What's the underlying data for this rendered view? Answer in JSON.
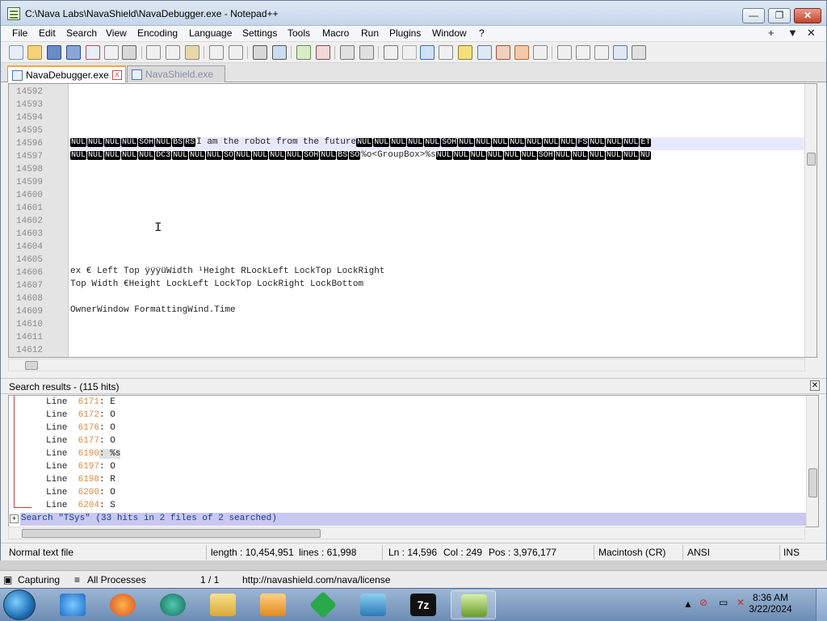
{
  "window": {
    "title": "C:\\Nava Labs\\NavaShield\\NavaDebugger.exe - Notepad++",
    "minimize": "—",
    "maximize": "❐",
    "close": "✕"
  },
  "menu": {
    "items": [
      "File",
      "Edit",
      "Search",
      "View",
      "Encoding",
      "Language",
      "Settings",
      "Tools",
      "Macro",
      "Run",
      "Plugins",
      "Window",
      "?"
    ],
    "right": [
      "+",
      "▼",
      "✕"
    ]
  },
  "tabs": [
    {
      "label": "NavaDebugger.exe",
      "active": true
    },
    {
      "label": "NavaShield.exe",
      "active": false
    }
  ],
  "editor": {
    "lines": [
      {
        "num": "14592",
        "text": ""
      },
      {
        "num": "14593",
        "text": ""
      },
      {
        "num": "14594",
        "text": ""
      },
      {
        "num": "14595",
        "text": ""
      },
      {
        "num": "14596",
        "text": "I am the robot from the future",
        "highlight": true
      },
      {
        "num": "14597",
        "text": "%o<GroupBox>%s"
      },
      {
        "num": "14598",
        "text": ""
      },
      {
        "num": "14599",
        "text": ""
      },
      {
        "num": "14600",
        "text": ""
      },
      {
        "num": "14601",
        "text": ""
      },
      {
        "num": "14602",
        "text": ""
      },
      {
        "num": "14603",
        "text": ""
      },
      {
        "num": "14604",
        "text": ""
      },
      {
        "num": "14605",
        "text": ""
      },
      {
        "num": "14606",
        "text": "ex €  Left   Top ÿÿÿüWidth  ¹Height  RLockLeft LockTop LockRight"
      },
      {
        "num": "14607",
        "text": "Top  Width  €Height  LockLeft LockTop LockRight LockBottom"
      },
      {
        "num": "14608",
        "text": ""
      },
      {
        "num": "14609",
        "text": "OwnerWindow  FormattingWind.Time"
      },
      {
        "num": "14610",
        "text": ""
      },
      {
        "num": "14611",
        "text": ""
      },
      {
        "num": "14612",
        "text": ""
      }
    ],
    "ctrl": {
      "l14596a": [
        "NUL",
        "NUL",
        "NUL",
        "NUL",
        "SOH",
        "NUL",
        "BS",
        "RS"
      ],
      "l14596b": [
        "NUL",
        "NUL",
        "NUL",
        "NUL",
        "NUL",
        "SOH",
        "NUL",
        "NUL",
        "NUL",
        "NUL",
        "NUL",
        "NUL",
        "NUL",
        "FS",
        "NUL",
        "NUL",
        "NUL",
        "ET"
      ],
      "l14597a": [
        "NUL",
        "NUL",
        "NUL",
        "NUL",
        "NUL",
        "DC3",
        "NUL",
        "NUL",
        "NUL",
        "SO",
        "NUL",
        "NUL",
        "NUL",
        "NUL",
        "SOH",
        "NUL",
        "BS",
        "SO"
      ],
      "l14597b": [
        "NUL",
        "NUL",
        "NUL",
        "NUL",
        "NUL",
        "NUL",
        "SOH",
        "NUL",
        "NUL",
        "NUL",
        "NUL",
        "NUL",
        "NU"
      ]
    }
  },
  "search_panel": {
    "title": "Search results - (115 hits)",
    "close": "✕",
    "results": [
      {
        "prefix": "Line  ",
        "num": "6171",
        "text": ": E"
      },
      {
        "prefix": "Line  ",
        "num": "6172",
        "text": ": O"
      },
      {
        "prefix": "Line  ",
        "num": "6176",
        "text": ": O"
      },
      {
        "prefix": "Line  ",
        "num": "6177",
        "text": ": O"
      },
      {
        "prefix": "Line  ",
        "num": "6190",
        "text": ": %s"
      },
      {
        "prefix": "Line  ",
        "num": "6197",
        "text": ": O"
      },
      {
        "prefix": "Line  ",
        "num": "6198",
        "text": ": R"
      },
      {
        "prefix": "Line  ",
        "num": "6200",
        "text": ": O"
      },
      {
        "prefix": "Line  ",
        "num": "6204",
        "text": ": S"
      }
    ],
    "summary": "Search \"TSys\" (33 hits in 2 files of 2 searched)"
  },
  "status": {
    "type": "Normal text file",
    "length": "length : 10,454,951",
    "lines": "lines : 61,998",
    "ln": "Ln : 14,596",
    "col": "Col : 249",
    "pos": "Pos : 3,976,177",
    "eol": "Macintosh (CR)",
    "encoding": "ANSI",
    "mode": "INS"
  },
  "capture_bar": {
    "capturing": "Capturing",
    "processes": "All Processes",
    "page": "1 / 1",
    "url": "http://navashield.com/nava/license"
  },
  "taskbar": {
    "time": "8:36 AM",
    "date": "3/22/2024"
  },
  "colors": {
    "accent": "#f3a740",
    "line_number_orange": "#e08a40",
    "search_header_bg": "#c8c8f0"
  }
}
